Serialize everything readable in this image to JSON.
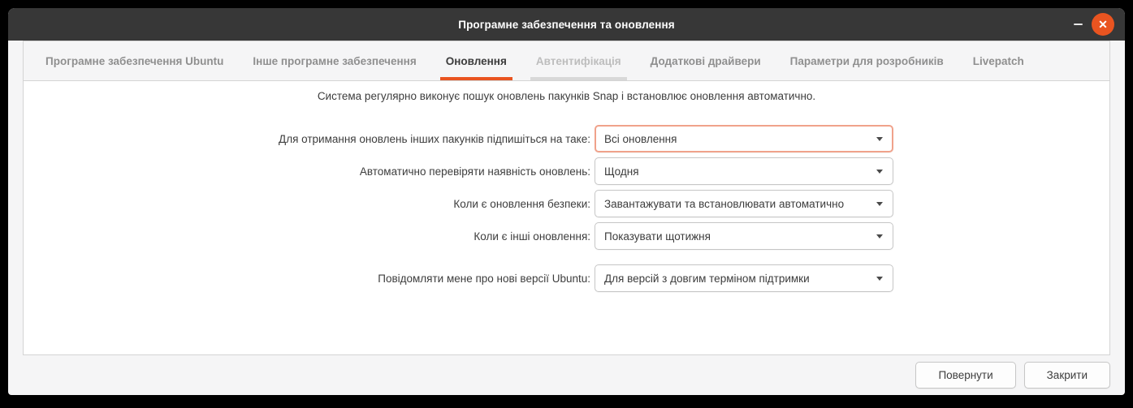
{
  "window": {
    "title": "Програмне забезпечення та оновлення",
    "close_glyph": "✕"
  },
  "tabs": [
    {
      "label": "Програмне забезпечення Ubuntu",
      "state": "normal"
    },
    {
      "label": "Інше програмне забезпечення",
      "state": "normal"
    },
    {
      "label": "Оновлення",
      "state": "active"
    },
    {
      "label": "Автентифікація",
      "state": "disabled"
    },
    {
      "label": "Додаткові драйвери",
      "state": "normal"
    },
    {
      "label": "Параметри для розробників",
      "state": "normal"
    },
    {
      "label": "Livepatch",
      "state": "normal"
    }
  ],
  "content": {
    "info_text": "Система регулярно виконує пошук оновлень пакунків Snap і встановлює оновлення автоматично.",
    "rows": [
      {
        "label": "Для отримання оновлень інших пакунків підпишіться на таке:",
        "value": "Всі оновлення",
        "focused": true
      },
      {
        "label": "Автоматично перевіряти наявність оновлень:",
        "value": "Щодня",
        "focused": false
      },
      {
        "label": "Коли є оновлення безпеки:",
        "value": "Завантажувати та встановлювати автоматично",
        "focused": false
      },
      {
        "label": "Коли є інші оновлення:",
        "value": "Показувати щотижня",
        "focused": false
      },
      {
        "label": "Повідомляти мене про нові версії Ubuntu:",
        "value": "Для версій з довгим терміном підтримки",
        "focused": false
      }
    ]
  },
  "footer": {
    "revert_label": "Повернути",
    "close_label": "Закрити"
  },
  "colors": {
    "accent": "#E95420",
    "titlebar": "#373737",
    "focus_border": "#f0a28b",
    "panel_bg": "#f5f5f6"
  }
}
